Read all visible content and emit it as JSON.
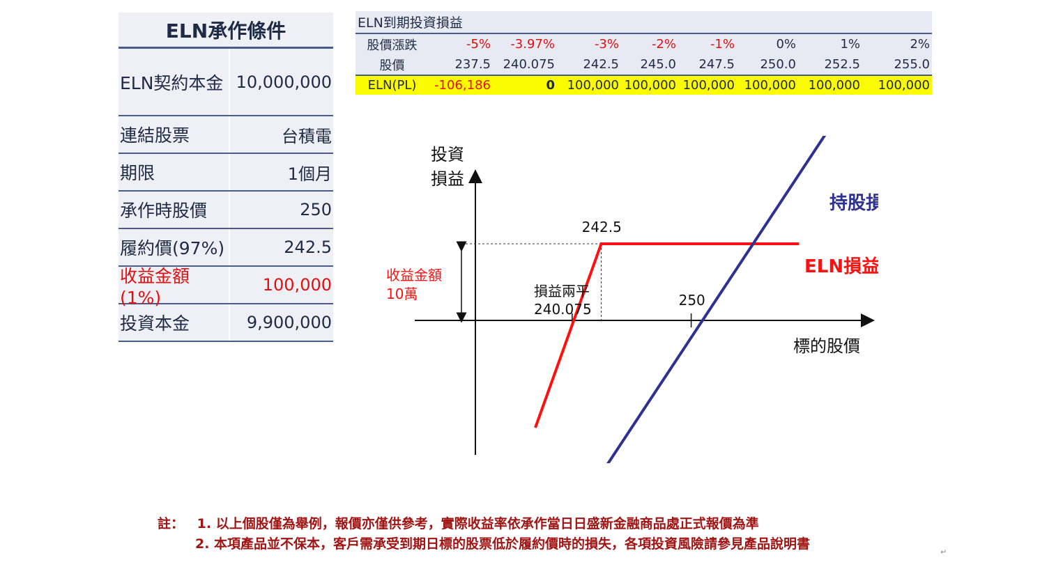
{
  "terms": {
    "title": "ELN承作條件",
    "rows": [
      {
        "label": "ELN契約本金",
        "value": "10,000,000"
      },
      {
        "label": "連結股票",
        "value": "台積電"
      },
      {
        "label": "期限",
        "value": "1個月"
      },
      {
        "label": "承作時股價",
        "value": "250"
      },
      {
        "label": "履約價(97%)",
        "value": "242.5"
      },
      {
        "label": "收益金額(1%)",
        "value": "100,000"
      },
      {
        "label": "投資本金",
        "value": "9,900,000"
      }
    ]
  },
  "payoff_table": {
    "title": "ELN到期投資損益",
    "row_labels": [
      "股價漲跌",
      "股價",
      "ELN(PL)"
    ],
    "change": [
      "-5%",
      "-3.97%",
      "-3%",
      "-2%",
      "-1%",
      "0%",
      "1%",
      "2%"
    ],
    "price": [
      "237.5",
      "240.075",
      "242.5",
      "245.0",
      "247.5",
      "250.0",
      "252.5",
      "255.0"
    ],
    "pl": [
      "-106,186",
      "0",
      "100,000",
      "100,000",
      "100,000",
      "100,000",
      "100,000",
      "100,000"
    ]
  },
  "chart_data": {
    "type": "line",
    "ylabel": "投資\n損益",
    "xlabel": "標的股價",
    "series": [
      {
        "name": "ELN損益",
        "color": "#ff1010",
        "x": [
          237.0,
          242.5,
          259.0
        ],
        "y": [
          -1.4,
          1.0,
          1.0
        ]
      },
      {
        "name": "持股損益",
        "color": "#2e3192",
        "x": [
          242.5,
          261.5
        ],
        "y": [
          -2.0,
          2.5
        ]
      }
    ],
    "annotations": {
      "strike": "242.5",
      "spot": "250",
      "breakeven_label": "損益兩平",
      "breakeven_value": "240.075",
      "income_label": "收益金額",
      "income_value": "10萬"
    }
  },
  "notes": {
    "prefix": "註：",
    "line1": "1. 以上個股僅為舉例，報價亦僅供參考，實際收益率依承作當日日盛新金融商品處正式報價為準",
    "line2": "2. 本項產品並不保本，客戶需承受到期日標的股票低於履約價時的損失，各項投資風險請參見產品說明書"
  },
  "colors": {
    "red": "#ff1010",
    "blue": "#2e3192",
    "yellow": "#fafa00"
  }
}
